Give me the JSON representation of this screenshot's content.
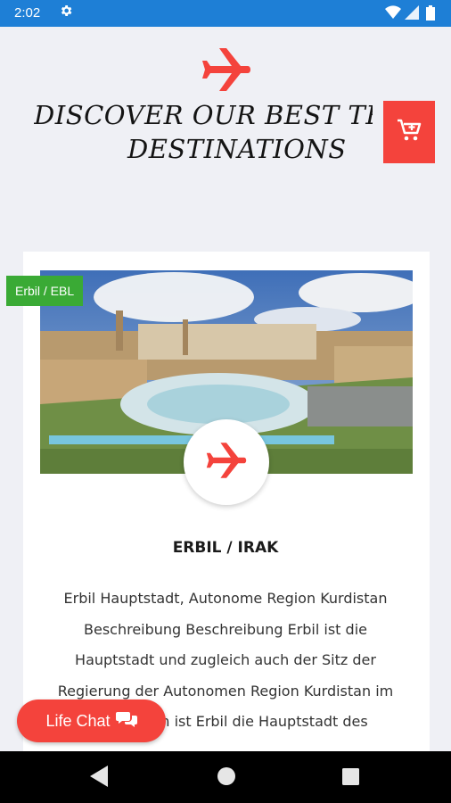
{
  "status_bar": {
    "time": "2:02",
    "icons": [
      "gear-icon",
      "wifi-icon",
      "signal-icon",
      "battery-icon"
    ]
  },
  "header": {
    "line1": "DISCOVER OUR BEST TRA",
    "line2": "DESTINATIONS",
    "cart_icon": "cart-plus-icon"
  },
  "destination": {
    "badge": "Erbil / EBL",
    "title": "ERBIL / IRAK",
    "description": "Erbil Hauptstadt, Autonome Region Kurdistan Beschreibung Beschreibung Erbil ist die Hauptstadt und zugleich auch der Sitz der Regierung der Autonomen Region Kurdistan im Irak. Zudem ist Erbil die Hauptstadt des"
  },
  "chat": {
    "label": "Life Chat",
    "icon": "chat-bubbles-icon"
  },
  "colors": {
    "accent": "#f4433c",
    "badge": "#3aaa35",
    "statusbar": "#1e7fd6"
  }
}
